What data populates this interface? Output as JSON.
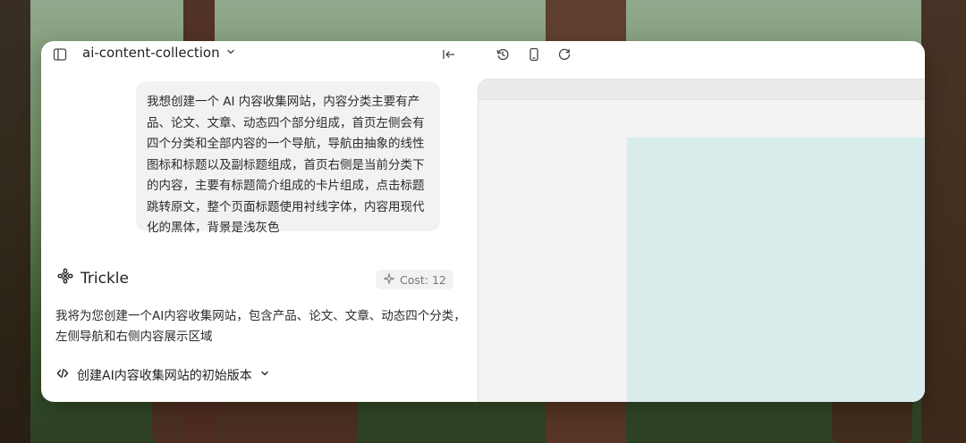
{
  "app": {
    "project_name": "ai-content-collection",
    "icons": {
      "sidebar_toggle": "sidebar-icon",
      "dropdown": "chevron-down-icon",
      "collapse_left": "collapse-left-icon",
      "history": "history-icon",
      "device": "phone-icon",
      "refresh": "refresh-icon"
    }
  },
  "chat": {
    "user_message": "我想创建一个 AI 内容收集网站，内容分类主要有产品、论文、文章、动态四个部分组成，首页左侧会有四个分类和全部内容的一个导航，导航由抽象的线性图标和标题以及副标题组成，首页右侧是当前分类下的内容，主要有标题简介组成的卡片组成，点击标题跳转原文，整个页面标题使用衬线字体，内容用现代化的黑体，背景是浅灰色",
    "assistant_name": "Trickle",
    "cost_label": "Cost: 12",
    "assistant_reply": "我将为您创建一个AI内容收集网站，包含产品、论文、文章、动态四个分类，左侧导航和右侧内容展示区域",
    "version_label": "创建AI内容收集网站的初始版本"
  },
  "colors": {
    "preview_background": "#f3f3f3",
    "preview_accent": "#d9ecec",
    "user_bubble": "#f2f2f2"
  }
}
